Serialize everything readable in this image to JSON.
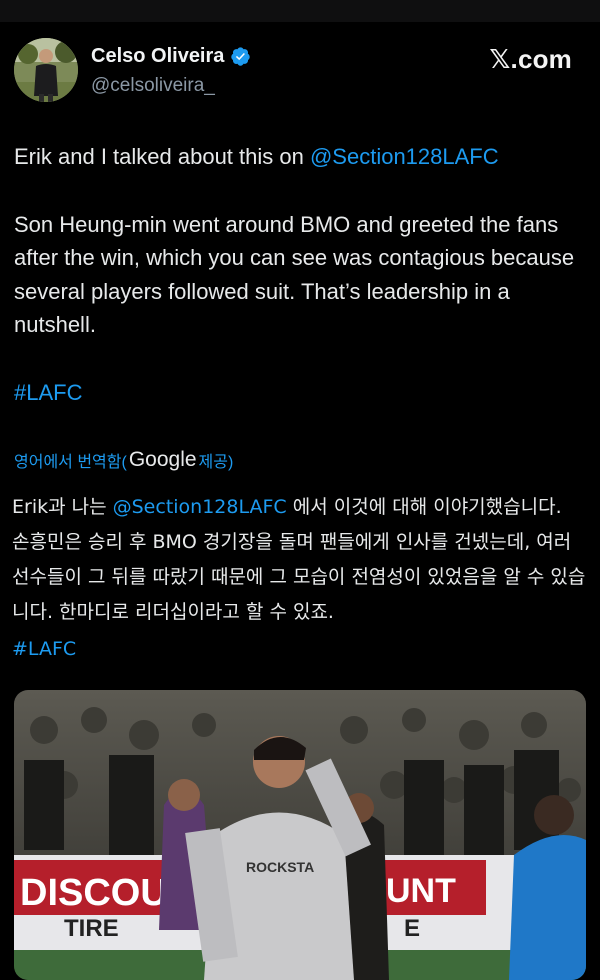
{
  "author": {
    "name": "Celso Oliveira",
    "handle": "@celsoliveira_",
    "verified": true
  },
  "brand": {
    "label": ".com",
    "x": "𝕏"
  },
  "tweet": {
    "line1_prefix": "Erik and I talked about this on ",
    "mention": "@Section128LAFC",
    "paragraph2": "Son Heung-min went around BMO and greeted the fans after the win, which you can see was contagious because several players followed suit. That’s leadership in a nutshell.",
    "hashtag": "#LAFC"
  },
  "translation": {
    "label_prefix": "영어에서 번역함(",
    "provider": "Google",
    "label_suffix": " 제공)",
    "line1_prefix": "Erik과 나는 ",
    "mention": "@Section128LAFC",
    "line1_suffix": " 에서 이것에 대해 이야기했습니다.",
    "paragraph2": "손흥민은 승리 후 BMO 경기장을 돌며 팬들에게 인사를 건넸는데, 여러 선수들이 그 뒤를 따랐기 때문에 그 모습이 전염성이 있었음을 알 수 있습니다. 한마디로 리더십이라고 할 수 있죠.",
    "hashtag": "#LAFC"
  },
  "media": {
    "banner_left": "DISCOU",
    "banner_left_sub": "TIRE",
    "banner_right": "UNT",
    "banner_right_sub": "E",
    "shirt_text": "ROCKSTA"
  },
  "colors": {
    "background": "#000000",
    "link": "#1d9bf0",
    "verified": "#1d9bf0",
    "secondary_text": "#8b98a5"
  }
}
